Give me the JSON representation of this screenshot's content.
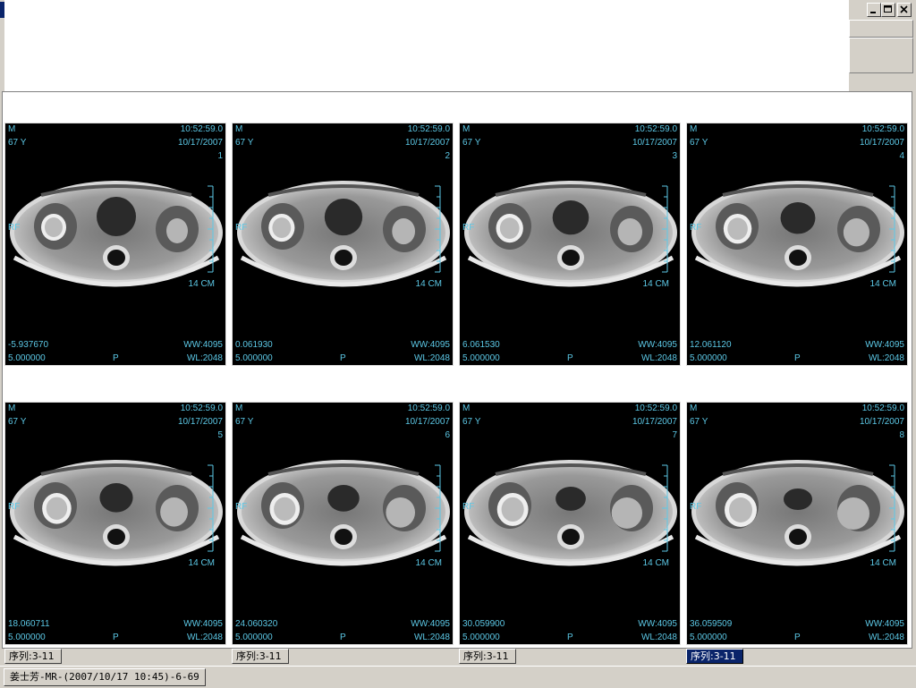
{
  "window": {
    "controls": [
      "minimize-icon",
      "maximize-icon",
      "close-icon"
    ]
  },
  "overlay_color": "#5cc8e6",
  "active_tab_color": "#0a246a",
  "viewports": [
    {
      "sex": "M",
      "age": "67 Y",
      "time": "10:52:59.0",
      "date": "10/17/2007",
      "index": "1",
      "orient": "RF",
      "scale": "14 CM",
      "position": "-5.937670",
      "thickness": "5.000000",
      "posterior": "P",
      "ww": "WW:4095",
      "wl": "WL:2048"
    },
    {
      "sex": "M",
      "age": "67 Y",
      "time": "10:52:59.0",
      "date": "10/17/2007",
      "index": "2",
      "orient": "RF",
      "scale": "14 CM",
      "position": "0.061930",
      "thickness": "5.000000",
      "posterior": "P",
      "ww": "WW:4095",
      "wl": "WL:2048"
    },
    {
      "sex": "M",
      "age": "67 Y",
      "time": "10:52:59.0",
      "date": "10/17/2007",
      "index": "3",
      "orient": "RF",
      "scale": "14 CM",
      "position": "6.061530",
      "thickness": "5.000000",
      "posterior": "P",
      "ww": "WW:4095",
      "wl": "WL:2048"
    },
    {
      "sex": "M",
      "age": "67 Y",
      "time": "10:52:59.0",
      "date": "10/17/2007",
      "index": "4",
      "orient": "RF",
      "scale": "14 CM",
      "position": "12.061120",
      "thickness": "5.000000",
      "posterior": "P",
      "ww": "WW:4095",
      "wl": "WL:2048"
    },
    {
      "sex": "M",
      "age": "67 Y",
      "time": "10:52:59.0",
      "date": "10/17/2007",
      "index": "5",
      "orient": "RF",
      "scale": "14 CM",
      "position": "18.060711",
      "thickness": "5.000000",
      "posterior": "P",
      "ww": "WW:4095",
      "wl": "WL:2048"
    },
    {
      "sex": "M",
      "age": "67 Y",
      "time": "10:52:59.0",
      "date": "10/17/2007",
      "index": "6",
      "orient": "RF",
      "scale": "14 CM",
      "position": "24.060320",
      "thickness": "5.000000",
      "posterior": "P",
      "ww": "WW:4095",
      "wl": "WL:2048"
    },
    {
      "sex": "M",
      "age": "67 Y",
      "time": "10:52:59.0",
      "date": "10/17/2007",
      "index": "7",
      "orient": "RF",
      "scale": "14 CM",
      "position": "30.059900",
      "thickness": "5.000000",
      "posterior": "P",
      "ww": "WW:4095",
      "wl": "WL:2048"
    },
    {
      "sex": "M",
      "age": "67 Y",
      "time": "10:52:59.0",
      "date": "10/17/2007",
      "index": "8",
      "orient": "RF",
      "scale": "14 CM",
      "position": "36.059509",
      "thickness": "5.000000",
      "posterior": "P",
      "ww": "WW:4095",
      "wl": "WL:2048"
    }
  ],
  "series_tabs": [
    {
      "label": "序列:3-11",
      "active": false
    },
    {
      "label": "序列:3-11",
      "active": false
    },
    {
      "label": "序列:3-11",
      "active": false
    },
    {
      "label": "序列:3-11",
      "active": true
    }
  ],
  "study_tab": {
    "label": "姜士芳-MR-(2007/10/17 10:45)-6-69"
  }
}
